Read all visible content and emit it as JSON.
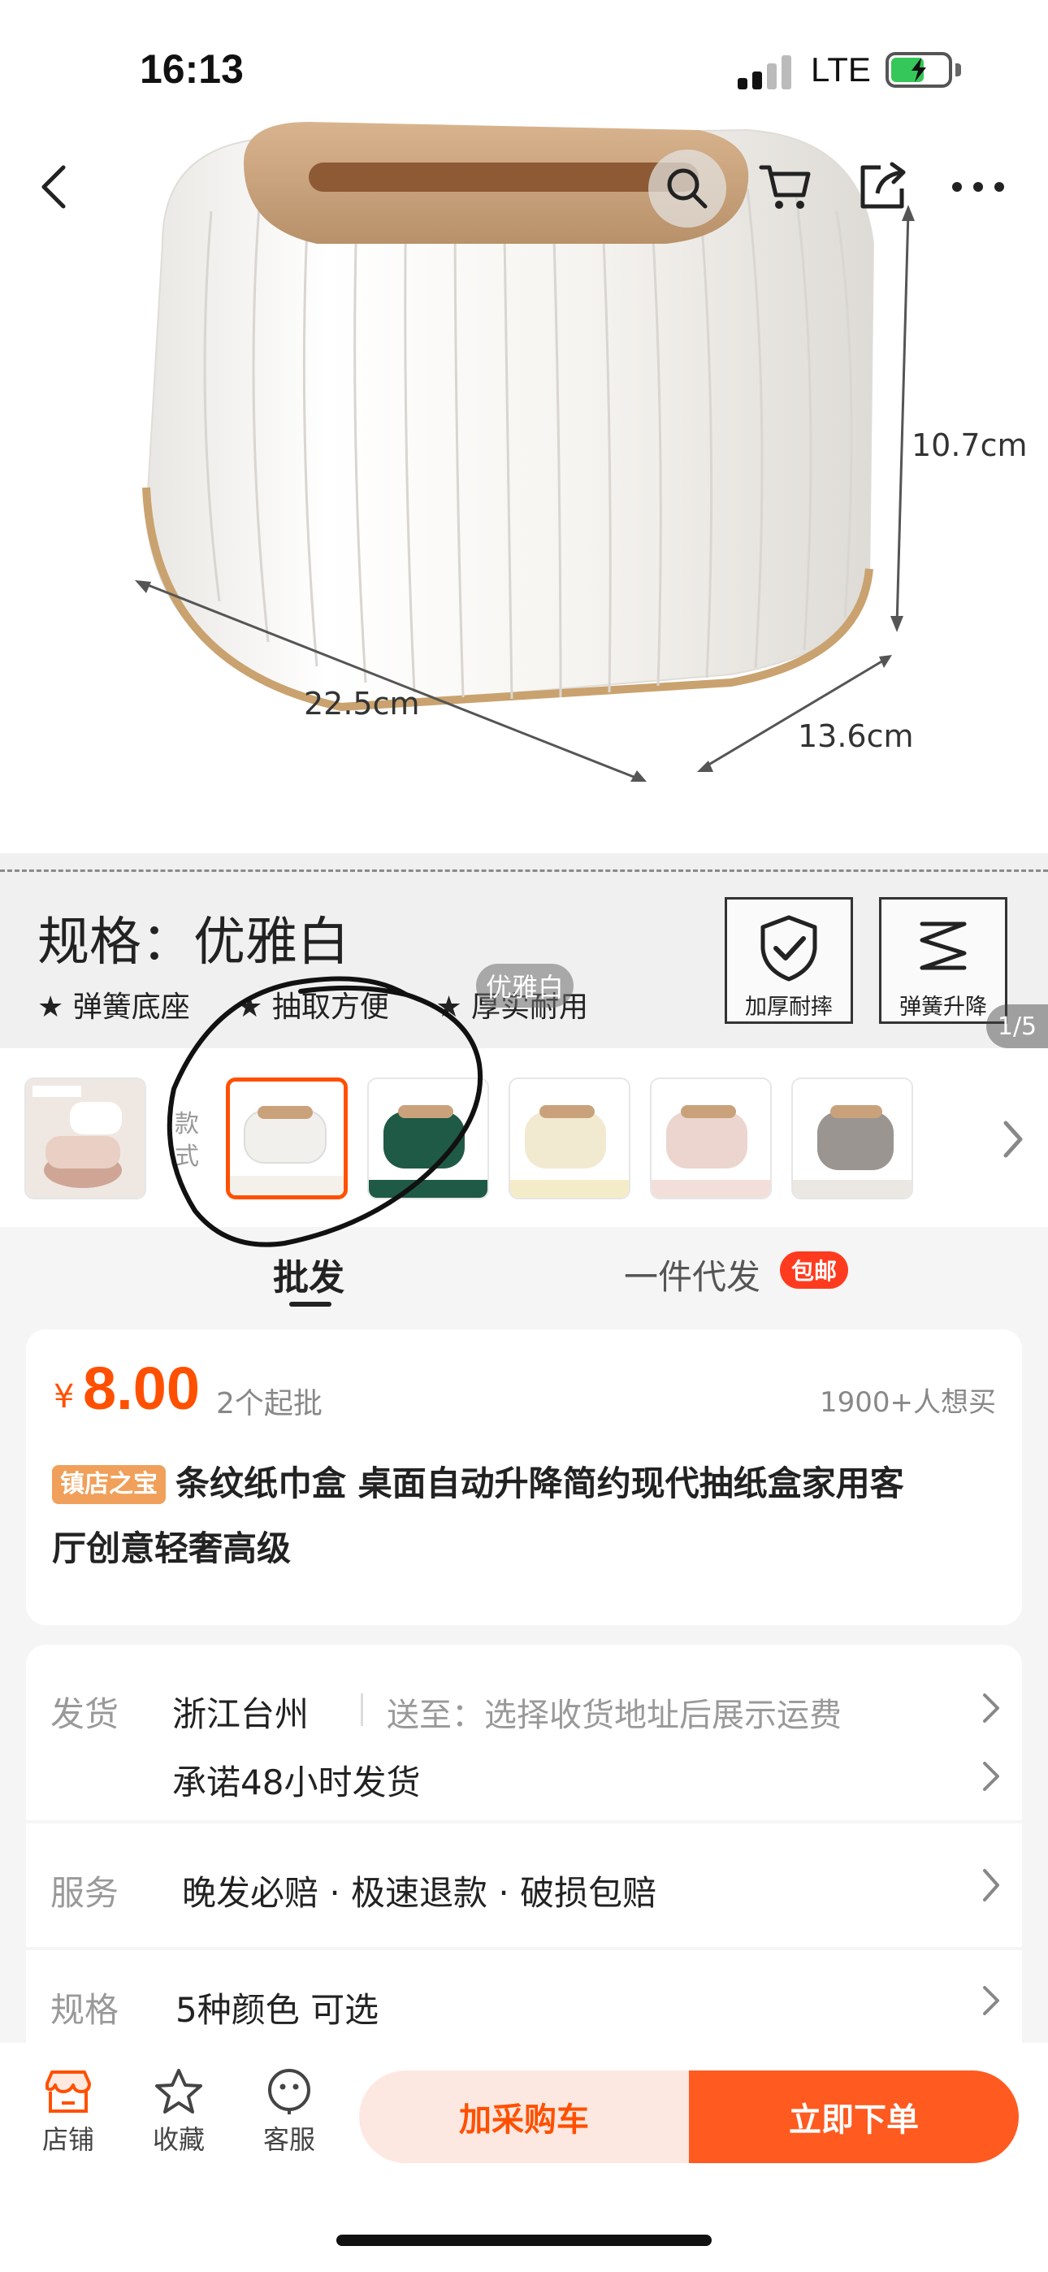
{
  "status_bar": {
    "time": "16:13",
    "network": "LTE"
  },
  "hero": {
    "dimensions": {
      "height": "10.7cm",
      "width": "22.5cm",
      "depth": "13.6cm"
    },
    "spec_title": "规格：优雅白",
    "features": [
      "★ 弹簧底座",
      "★ 抽取方便",
      "★ 厚实耐用"
    ],
    "badges": [
      {
        "label": "加厚耐摔",
        "icon": "shield-check-icon"
      },
      {
        "label": "弹簧升降",
        "icon": "spring-icon"
      }
    ],
    "color_tag": "优雅白",
    "page_counter": "1/5"
  },
  "thumbnails": {
    "style_label": "款式",
    "items": [
      {
        "name": "pink",
        "color": "#e8c9c0"
      },
      {
        "name": "white",
        "color": "#f2f0ec",
        "selected": true
      },
      {
        "name": "green",
        "color": "#1f5a46"
      },
      {
        "name": "cream",
        "color": "#f1ead0"
      },
      {
        "name": "pink-light",
        "color": "#ecd5cf"
      },
      {
        "name": "gray",
        "color": "#9a9590"
      }
    ]
  },
  "tabs": {
    "wholesale": "批发",
    "dropship": "一件代发",
    "free_ship": "包邮"
  },
  "price_card": {
    "currency": "¥",
    "price": "8.00",
    "min_order": "2个起批",
    "want_count": "1900+人想买",
    "shop_badge": "镇店之宝",
    "title_line1": "条纹纸巾盒 桌面自动升降简约现代抽纸盒家用客",
    "title_line2": "厅创意轻奢高级"
  },
  "shipping": {
    "key": "发货",
    "origin": "浙江台州",
    "deliver_to": "送至：选择收货地址后展示运费",
    "promise": "承诺48小时发货"
  },
  "service": {
    "key": "服务",
    "value": "晚发必赔 · 极速退款 · 破损包赔"
  },
  "spec": {
    "key": "规格",
    "value": "5种颜色 可选"
  },
  "bottom_bar": {
    "shop": "店铺",
    "favorite": "收藏",
    "support": "客服",
    "add_cart": "加采购车",
    "buy_now": "立即下单"
  },
  "colors": {
    "accent": "#ff5000",
    "accent_light": "#fde8e1",
    "badge_orange": "#f0a05a",
    "free_ship_red": "#ff3b1f"
  }
}
